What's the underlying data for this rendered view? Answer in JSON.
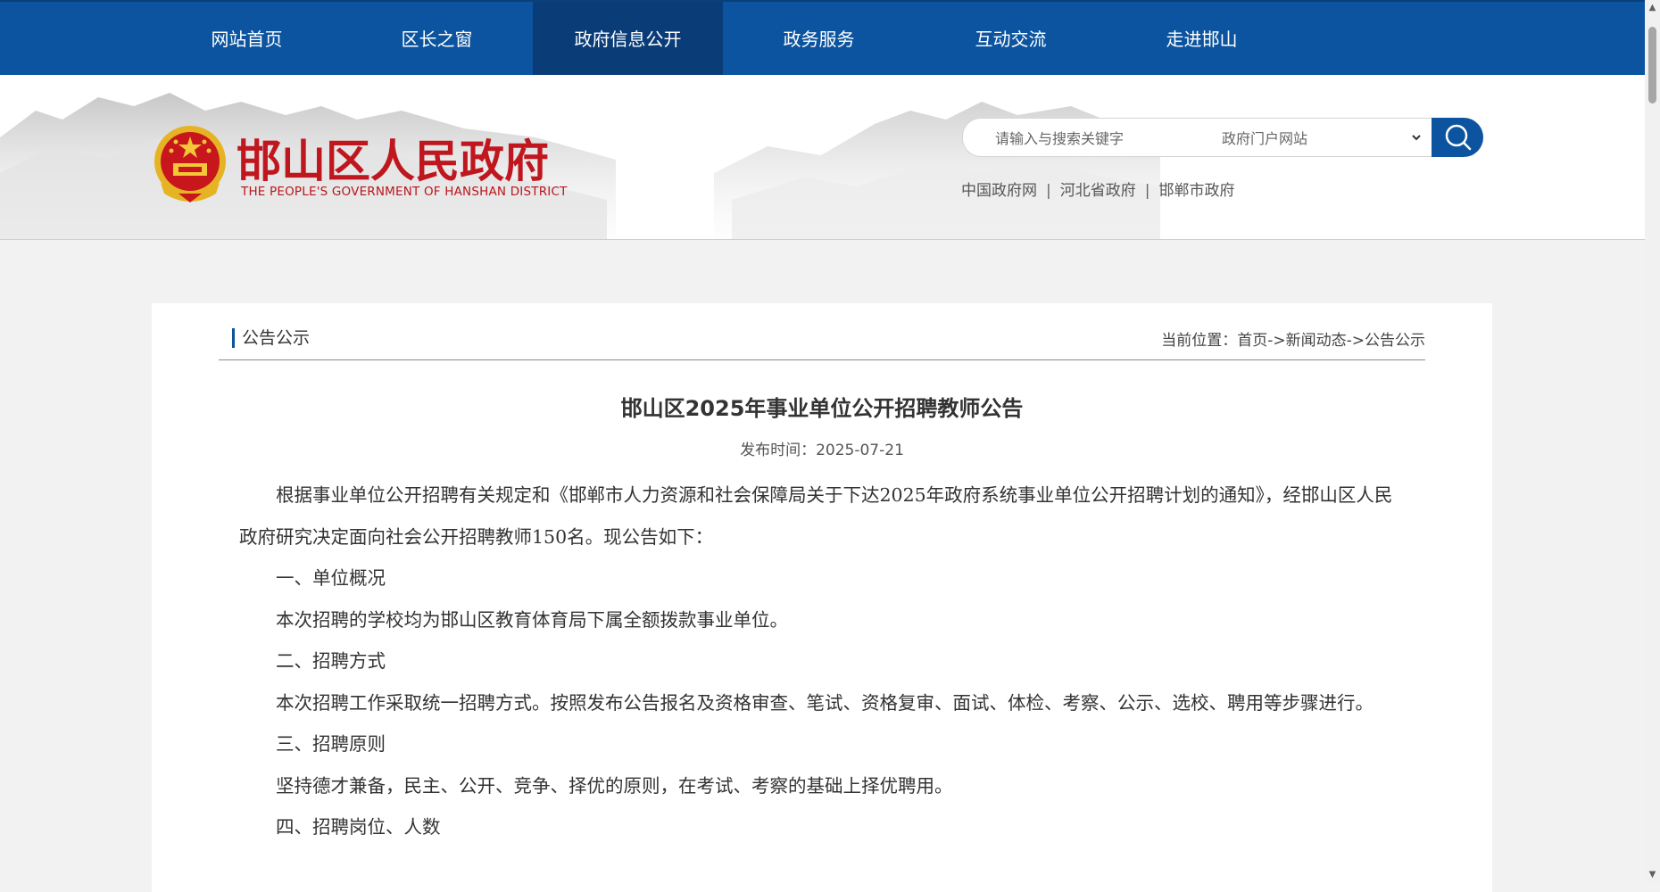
{
  "nav": {
    "items": [
      {
        "label": "网站首页"
      },
      {
        "label": "区长之窗"
      },
      {
        "label": "政府信息公开"
      },
      {
        "label": "政务服务"
      },
      {
        "label": "互动交流"
      },
      {
        "label": "走进邯山"
      }
    ],
    "active_index": 2
  },
  "header": {
    "logo_cn": "邯山区人民政府",
    "logo_en": "THE PEOPLE'S GOVERNMENT OF HANSHAN DISTRICT",
    "search": {
      "placeholder": "请输入与搜索关键字",
      "scope_selected": "政府门户网站"
    },
    "links": [
      {
        "label": "中国政府网"
      },
      {
        "label": "河北省政府"
      },
      {
        "label": "邯郸市政府"
      }
    ],
    "link_separator": "|"
  },
  "section": {
    "title": "公告公示",
    "breadcrumb_prefix": "当前位置：",
    "breadcrumb": [
      {
        "label": "首页"
      },
      {
        "label": "新闻动态"
      },
      {
        "label": "公告公示"
      }
    ],
    "breadcrumb_separator": "->"
  },
  "article": {
    "title": "邯山区2025年事业单位公开招聘教师公告",
    "date_label": "发布时间：",
    "date": "2025-07-21",
    "paragraphs": [
      "根据事业单位公开招聘有关规定和《邯郸市人力资源和社会保障局关于下达2025年政府系统事业单位公开招聘计划的通知》，经邯山区人民政府研究决定面向社会公开招聘教师150名。现公告如下：",
      "一、单位概况",
      "本次招聘的学校均为邯山区教育体育局下属全额拨款事业单位。",
      "二、招聘方式",
      "本次招聘工作采取统一招聘方式。按照发布公告报名及资格审查、笔试、资格复审、面试、体检、考察、公示、选校、聘用等步骤进行。",
      "三、招聘原则",
      "坚持德才兼备，民主、公开、竞争、择优的原则，在考试、考察的基础上择优聘用。",
      "四、招聘岗位、人数"
    ]
  },
  "colors": {
    "nav_bg": "#0c549f",
    "nav_active_bg": "#0a3d78",
    "logo_red": "#c0171f",
    "page_bg": "#f2f2f2"
  }
}
